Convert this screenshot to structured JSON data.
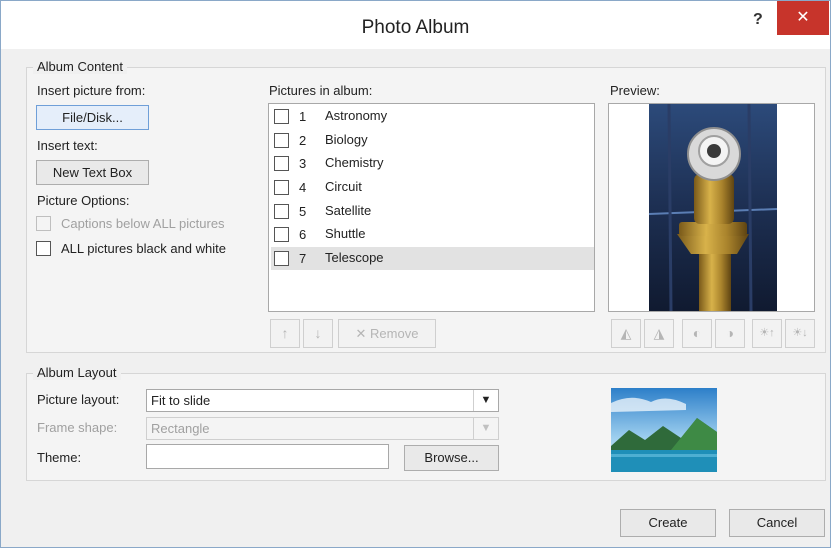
{
  "window": {
    "title": "Photo Album",
    "help_label": "?",
    "close_label": "✕"
  },
  "album_content": {
    "title": "Album Content",
    "insert_picture_label": "Insert picture from:",
    "file_disk_button": "File/Disk...",
    "insert_text_label": "Insert text:",
    "new_text_box_button": "New Text Box",
    "picture_options_label": "Picture Options:",
    "captions_label": "Captions below ALL pictures",
    "black_white_label": "ALL pictures black and white",
    "pictures_label": "Pictures in album:",
    "pictures": [
      {
        "num": "1",
        "name": "Astronomy"
      },
      {
        "num": "2",
        "name": "Biology"
      },
      {
        "num": "3",
        "name": "Chemistry"
      },
      {
        "num": "4",
        "name": "Circuit"
      },
      {
        "num": "5",
        "name": "Satellite"
      },
      {
        "num": "6",
        "name": "Shuttle"
      },
      {
        "num": "7",
        "name": "Telescope"
      }
    ],
    "selected_picture": "7",
    "move_up_icon": "↑",
    "move_down_icon": "↓",
    "remove_label": "✕ Remove",
    "preview_label": "Preview:",
    "preview_tools": [
      "◭",
      "◮",
      "◐",
      "◑",
      "☀↑",
      "☀↓"
    ]
  },
  "album_layout": {
    "title": "Album Layout",
    "picture_layout_label": "Picture layout:",
    "picture_layout_value": "Fit to slide",
    "frame_shape_label": "Frame shape:",
    "frame_shape_value": "Rectangle",
    "theme_label": "Theme:",
    "theme_value": "",
    "browse_button": "Browse..."
  },
  "footer": {
    "create_button": "Create",
    "cancel_button": "Cancel"
  },
  "colors": {
    "close_bg": "#c7342b",
    "selection": "#e2e2e2",
    "focus_border": "#6f9fd8"
  }
}
